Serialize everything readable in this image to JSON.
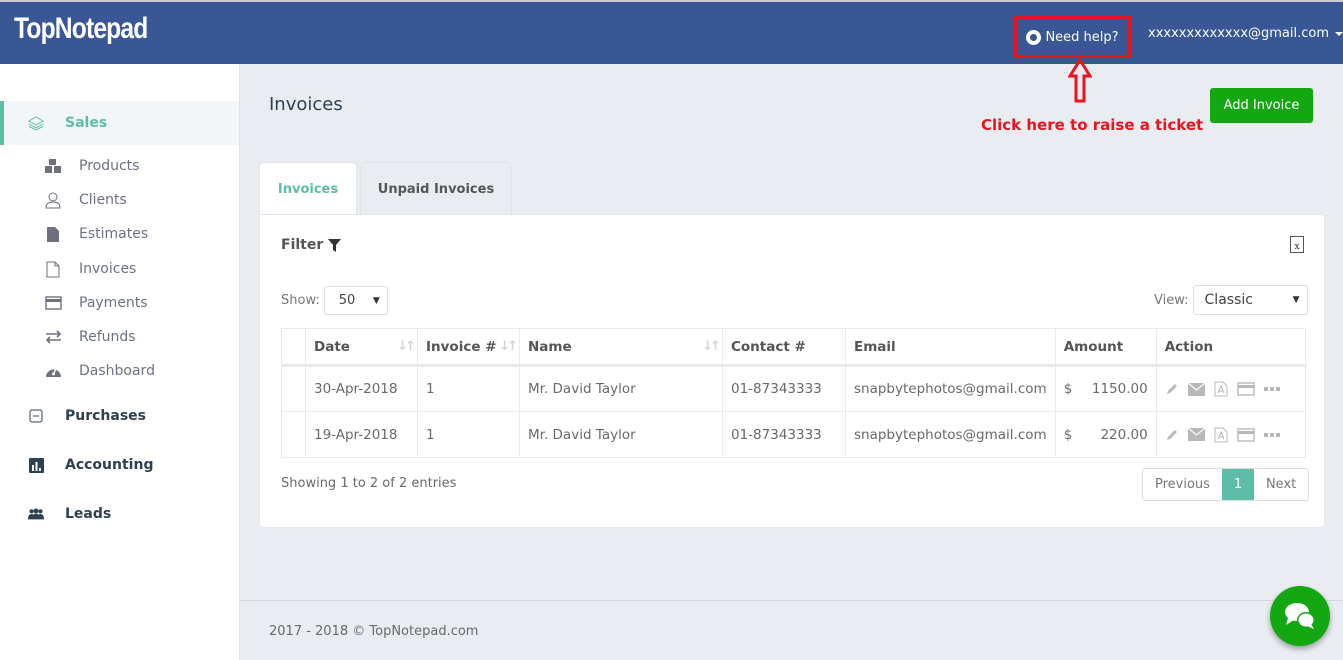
{
  "header": {
    "logo": "TopNotepad",
    "help_label": "Need help?",
    "user_email": "xxxxxxxxxxxxx@gmail.com"
  },
  "annotation": {
    "text": "Click here to raise a ticket",
    "color": "#e8141f"
  },
  "sidebar": {
    "sections": [
      {
        "label": "Sales",
        "icon": "layers-icon",
        "active": true
      },
      {
        "label": "Purchases",
        "icon": "minus-square-icon"
      },
      {
        "label": "Accounting",
        "icon": "bar-chart-icon"
      },
      {
        "label": "Leads",
        "icon": "users-icon"
      }
    ],
    "sales_items": [
      {
        "label": "Products",
        "icon": "cubes-icon"
      },
      {
        "label": "Clients",
        "icon": "user-icon"
      },
      {
        "label": "Estimates",
        "icon": "file-filled-icon"
      },
      {
        "label": "Invoices",
        "icon": "file-outline-icon"
      },
      {
        "label": "Payments",
        "icon": "credit-card-icon"
      },
      {
        "label": "Refunds",
        "icon": "exchange-icon"
      },
      {
        "label": "Dashboard",
        "icon": "dashboard-icon"
      }
    ]
  },
  "main": {
    "title": "Invoices",
    "add_button": "Add Invoice",
    "tabs": [
      {
        "label": "Invoices",
        "active": true
      },
      {
        "label": "Unpaid Invoices",
        "active": false
      }
    ],
    "filter_label": "Filter",
    "show_label": "Show:",
    "show_value": "50",
    "view_label": "View:",
    "view_value": "Classic",
    "table": {
      "columns": [
        "",
        "Date",
        "Invoice #",
        "Name",
        "Contact #",
        "Email",
        "Amount",
        "Action"
      ],
      "rows": [
        {
          "date": "30-Apr-2018",
          "invoice": "1",
          "name": "Mr. David Taylor",
          "contact": "01-87343333",
          "email": "snapbytephotos@gmail.com",
          "currency": "$",
          "amount": "1150.00"
        },
        {
          "date": "19-Apr-2018",
          "invoice": "1",
          "name": "Mr. David Taylor",
          "contact": "01-87343333",
          "email": "snapbytephotos@gmail.com",
          "currency": "$",
          "amount": "220.00"
        }
      ]
    },
    "showing": "Showing 1 to 2 of 2 entries",
    "pagination": {
      "previous": "Previous",
      "current": "1",
      "next": "Next"
    }
  },
  "footer": {
    "text": "2017 - 2018 © TopNotepad.com"
  },
  "colors": {
    "brand": "#3a5795",
    "accent": "#5ebda7",
    "success": "#13a812"
  }
}
